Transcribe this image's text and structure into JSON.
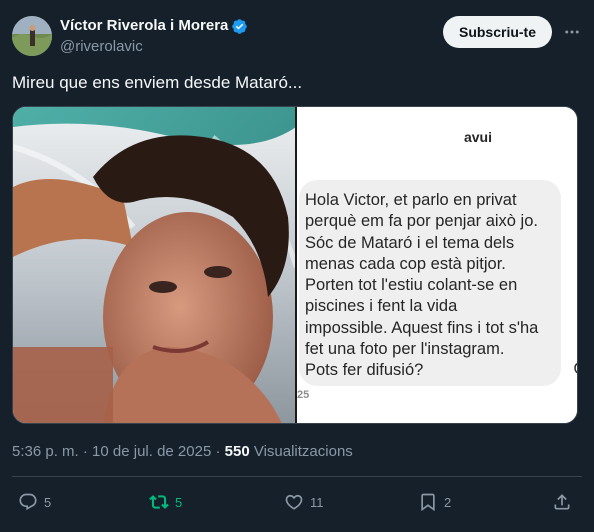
{
  "author": {
    "display_name": "Víctor Riverola i Morera",
    "handle": "@riverolavic",
    "verified": true
  },
  "header": {
    "subscribe_label": "Subscriu-te",
    "more_icon": "more-icon"
  },
  "tweet": {
    "text": "Mireu que ens enviem desde Mataró..."
  },
  "media": {
    "chat_header": "avui",
    "message": "Hola Victor, et parlo en privat\nperquè em fa por penjar això jo.\nSóc de Mataró i el tema dels\nmenas cada cop està pitjor.\nPorten tot l'estiu colant-se en\npiscines i fent la vida\nimpossible. Aquest fins i tot s'ha\nfet una foto per l'instagram.\nPots fer difusió?",
    "message_time": "25"
  },
  "meta": {
    "timestamp": "5:36 p. m. · 10 de jul. de 2025 · ",
    "views_count": "550",
    "views_label": " Visualitzacions"
  },
  "actions": {
    "replies": "5",
    "reposts": "5",
    "likes": "11",
    "bookmarks": "2"
  },
  "colors": {
    "background": "#15202b",
    "secondary_text": "#8b98a5",
    "verified": "#1d9bf0",
    "repost_active": "#00ba7c"
  }
}
